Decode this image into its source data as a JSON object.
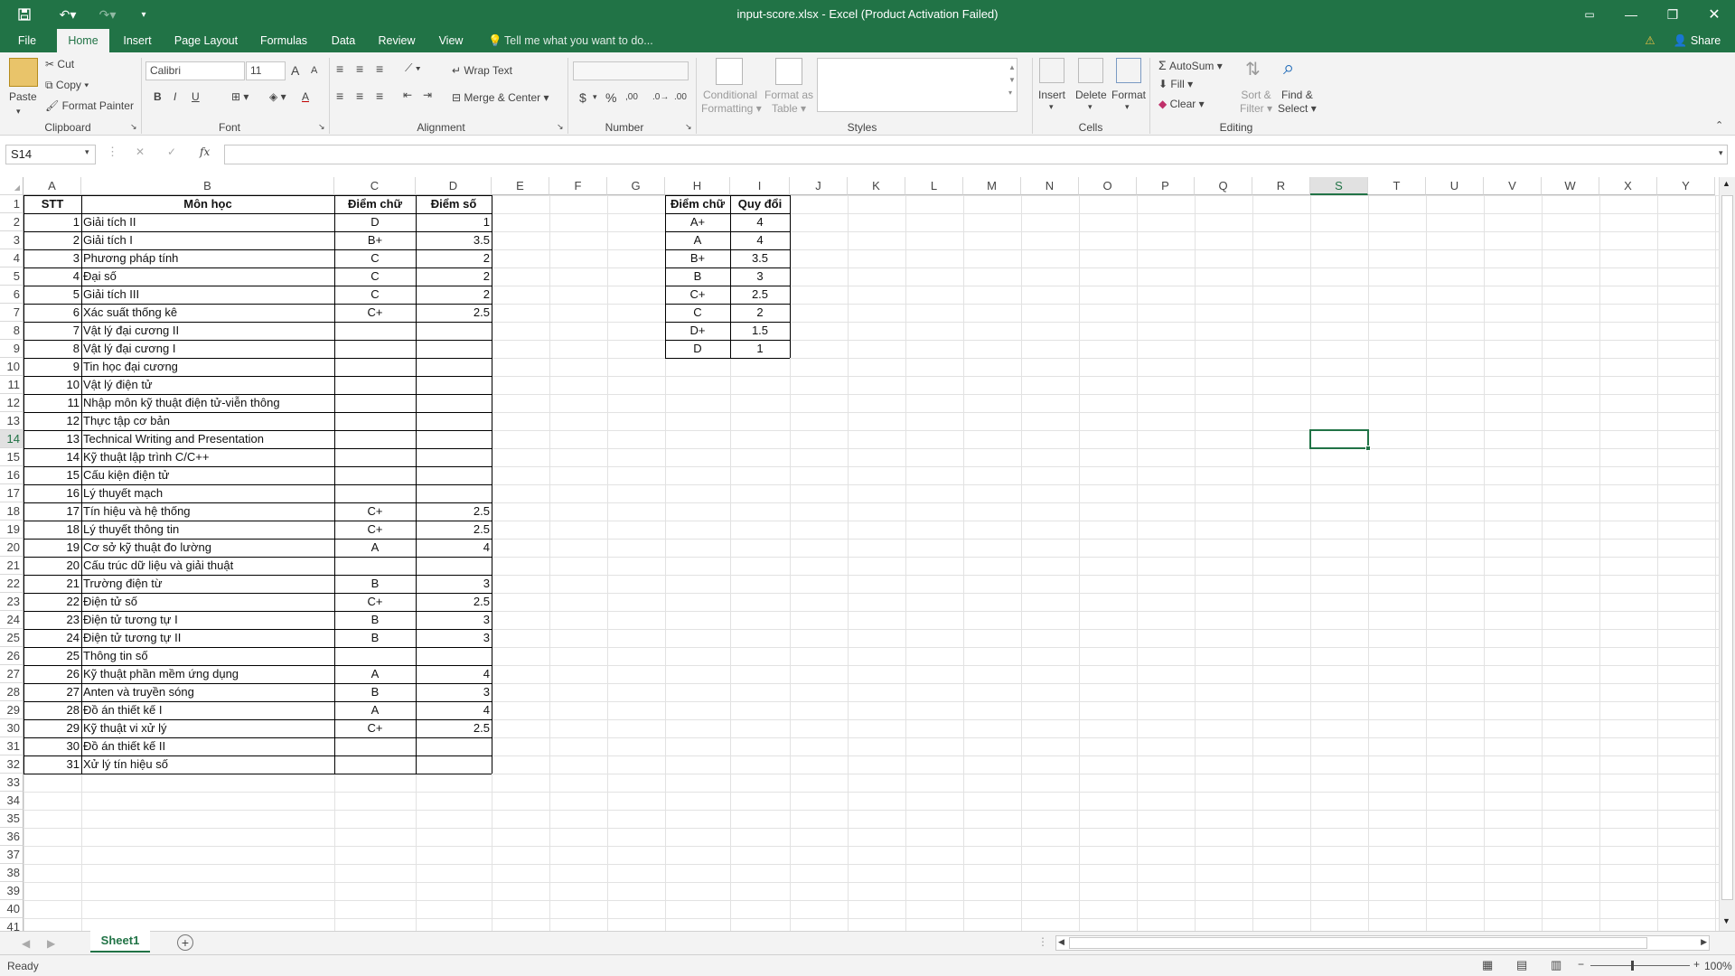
{
  "window": {
    "title": "input-score.xlsx - Excel (Product Activation Failed)"
  },
  "ribbon_tabs": [
    "File",
    "Home",
    "Insert",
    "Page Layout",
    "Formulas",
    "Data",
    "Review",
    "View"
  ],
  "active_tab": "Home",
  "tell_me": "Tell me what you want to do...",
  "share": "Share",
  "ribbon": {
    "clipboard": {
      "paste": "Paste",
      "cut": "Cut",
      "copy": "Copy",
      "format_painter": "Format Painter",
      "label": "Clipboard"
    },
    "font": {
      "name": "Calibri",
      "size": "11",
      "label": "Font",
      "bold": "B",
      "italic": "I",
      "underline": "U",
      "grow": "A",
      "shrink": "A",
      "color": "A"
    },
    "alignment": {
      "wrap_text": "Wrap Text",
      "merge_center": "Merge & Center",
      "label": "Alignment"
    },
    "number": {
      "format": "",
      "label": "Number",
      "currency": "$",
      "percent": "%"
    },
    "styles": {
      "conditional": "Conditional",
      "conditional2": "Formatting",
      "format_as": "Format as",
      "format_as2": "Table",
      "label": "Styles"
    },
    "cells": {
      "insert": "Insert",
      "delete": "Delete",
      "format": "Format",
      "label": "Cells"
    },
    "editing": {
      "autosum": "AutoSum",
      "fill": "Fill",
      "clear": "Clear",
      "sort": "Sort &",
      "sort2": "Filter",
      "find": "Find &",
      "find2": "Select",
      "label": "Editing"
    }
  },
  "formula_bar": {
    "name_box": "S14",
    "fx": "fx",
    "cancel": "✕",
    "enter": "✓",
    "content": ""
  },
  "columns": [
    "A",
    "B",
    "C",
    "D",
    "E",
    "F",
    "G",
    "H",
    "I",
    "J",
    "K",
    "L",
    "M",
    "N",
    "O",
    "P",
    "Q",
    "R",
    "S",
    "T",
    "U",
    "V",
    "W",
    "X",
    "Y"
  ],
  "selected_column": "S",
  "selected_row": 14,
  "row_numbers": [
    "1",
    "2",
    "3",
    "4",
    "5",
    "6",
    "7",
    "8",
    "9",
    "10",
    "11",
    "12",
    "13",
    "14",
    "15",
    "16",
    "17",
    "18",
    "19",
    "20",
    "21",
    "22",
    "23",
    "24",
    "25",
    "26",
    "27",
    "28",
    "29",
    "30",
    "31",
    "32",
    "33",
    "34",
    "35",
    "36",
    "37",
    "38",
    "39",
    "40",
    "41"
  ],
  "table": {
    "headers": [
      "STT",
      "Môn học",
      "Điểm chữ",
      "Điểm số"
    ],
    "rows": [
      [
        "1",
        "Giải tích II",
        "D",
        "1"
      ],
      [
        "2",
        "Giải tích I",
        "B+",
        "3.5"
      ],
      [
        "3",
        "Phương pháp tính",
        "C",
        "2"
      ],
      [
        "4",
        "Đại số",
        "C",
        "2"
      ],
      [
        "5",
        "Giải tích III",
        "C",
        "2"
      ],
      [
        "6",
        "Xác suất thống kê",
        "C+",
        "2.5"
      ],
      [
        "7",
        "Vật lý đại cương II",
        "",
        ""
      ],
      [
        "8",
        "Vật lý đại cương I",
        "",
        ""
      ],
      [
        "9",
        "Tin học đại cương",
        "",
        ""
      ],
      [
        "10",
        "Vật lý điện tử",
        "",
        ""
      ],
      [
        "11",
        "Nhập môn kỹ thuật điện tử-viễn thông",
        "",
        ""
      ],
      [
        "12",
        "Thực tập cơ bản",
        "",
        ""
      ],
      [
        "13",
        "Technical Writing and Presentation",
        "",
        ""
      ],
      [
        "14",
        "Kỹ thuật lập trình C/C++",
        "",
        ""
      ],
      [
        "15",
        "Cấu kiện điện tử",
        "",
        ""
      ],
      [
        "16",
        "Lý thuyết mạch",
        "",
        ""
      ],
      [
        "17",
        "Tín hiệu và hệ thống",
        "C+",
        "2.5"
      ],
      [
        "18",
        "Lý thuyết thông tin",
        "C+",
        "2.5"
      ],
      [
        "19",
        "Cơ sở kỹ thuật đo lường",
        "A",
        "4"
      ],
      [
        "20",
        "Cấu trúc dữ liệu và giải thuật",
        "",
        ""
      ],
      [
        "21",
        "Trường điện từ",
        "B",
        "3"
      ],
      [
        "22",
        "Điện tử số",
        "C+",
        "2.5"
      ],
      [
        "23",
        "Điện tử tương tự I",
        "B",
        "3"
      ],
      [
        "24",
        "Điện tử tương tự II",
        "B",
        "3"
      ],
      [
        "25",
        "Thông tin số",
        "",
        ""
      ],
      [
        "26",
        "Kỹ thuật phần mềm ứng dụng",
        "A",
        "4"
      ],
      [
        "27",
        "Anten và truyền sóng",
        "B",
        "3"
      ],
      [
        "28",
        "Đồ án thiết kế I",
        "A",
        "4"
      ],
      [
        "29",
        "Kỹ thuật vi xử lý",
        "C+",
        "2.5"
      ],
      [
        "30",
        "Đồ án thiết kế II",
        "",
        ""
      ],
      [
        "31",
        "Xử lý tín hiệu số",
        "",
        ""
      ]
    ]
  },
  "lookup": {
    "headers": [
      "Điểm chữ",
      "Quy đổi"
    ],
    "rows": [
      [
        "A+",
        "4"
      ],
      [
        "A",
        "4"
      ],
      [
        "B+",
        "3.5"
      ],
      [
        "B",
        "3"
      ],
      [
        "C+",
        "2.5"
      ],
      [
        "C",
        "2"
      ],
      [
        "D+",
        "1.5"
      ],
      [
        "D",
        "1"
      ]
    ]
  },
  "sheet_tabs": [
    "Sheet1"
  ],
  "status": {
    "ready": "Ready",
    "zoom": "100%"
  }
}
